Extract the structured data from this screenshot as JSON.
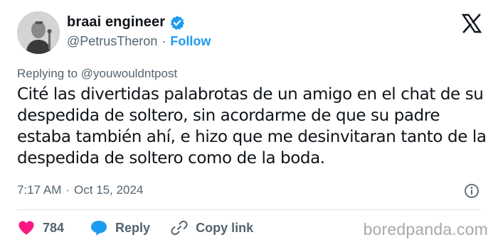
{
  "author": {
    "display_name": "braai engineer",
    "handle": "@PetrusTheron",
    "separator": "·",
    "follow_label": "Follow"
  },
  "reply_context": {
    "label": "Replying to",
    "mention": "@youwouldntpost"
  },
  "tweet": {
    "text": "Cité las divertidas palabrotas de un amigo en el chat de su despedida de soltero, sin acordarme de que su padre estaba también ahí, e hizo que me desinvitaran tanto de la despedida de soltero como de la boda.",
    "time": "7:17 AM",
    "separator": "·",
    "date": "Oct 15, 2024"
  },
  "actions": {
    "like_count": "784",
    "reply_label": "Reply",
    "copy_label": "Copy link"
  },
  "watermark": "boredpanda.com",
  "colors": {
    "link_blue": "#1d9bf0",
    "like_pink": "#f91880",
    "muted_gray": "#536471",
    "verified_blue": "#1d9bf0"
  },
  "icons": {
    "brand": "x-logo-icon",
    "verified": "verified-badge-icon",
    "info": "info-icon",
    "like": "heart-icon",
    "reply": "reply-bubble-icon",
    "copy": "link-icon"
  }
}
